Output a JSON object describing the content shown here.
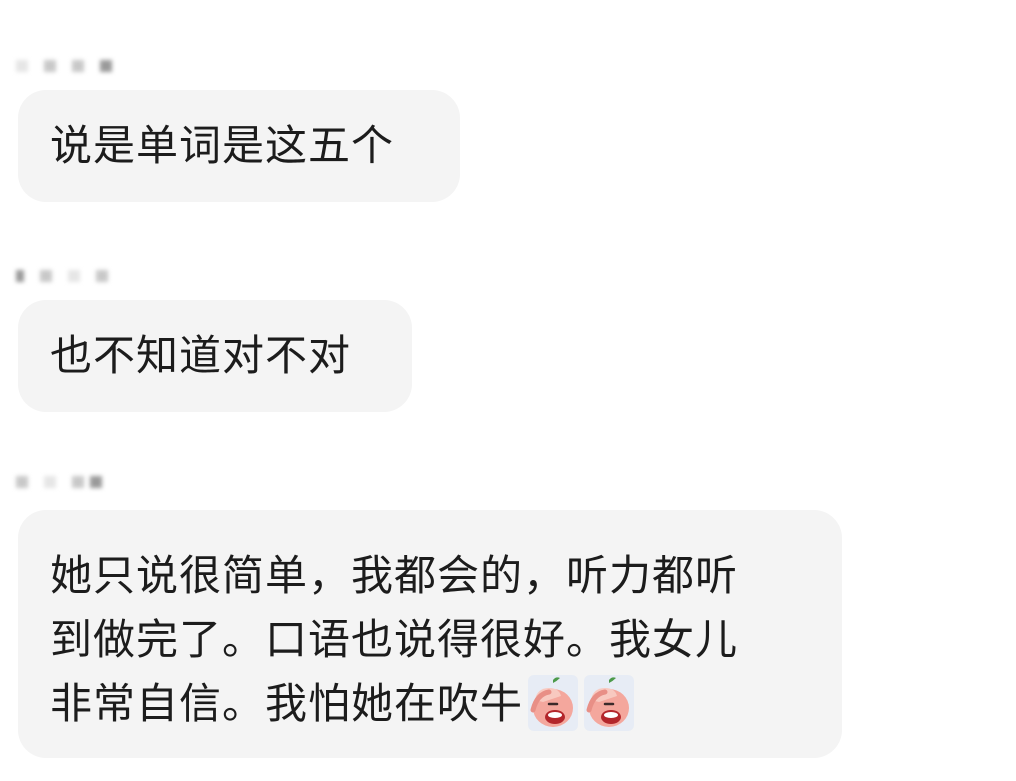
{
  "messages": [
    {
      "text": "说是单词是这五个"
    },
    {
      "text": "也不知道对不对"
    },
    {
      "lines": [
        "她只说很简单，我都会的，听力都听",
        "到做完了。口语也说得很好。我女儿",
        "非常自信。我怕她在吹牛"
      ],
      "emojis": [
        "facepalm-peach-icon",
        "facepalm-peach-icon"
      ]
    }
  ],
  "colors": {
    "bubble_background": "#f4f4f4",
    "text": "#1c1c1c",
    "page_background": "#ffffff"
  }
}
